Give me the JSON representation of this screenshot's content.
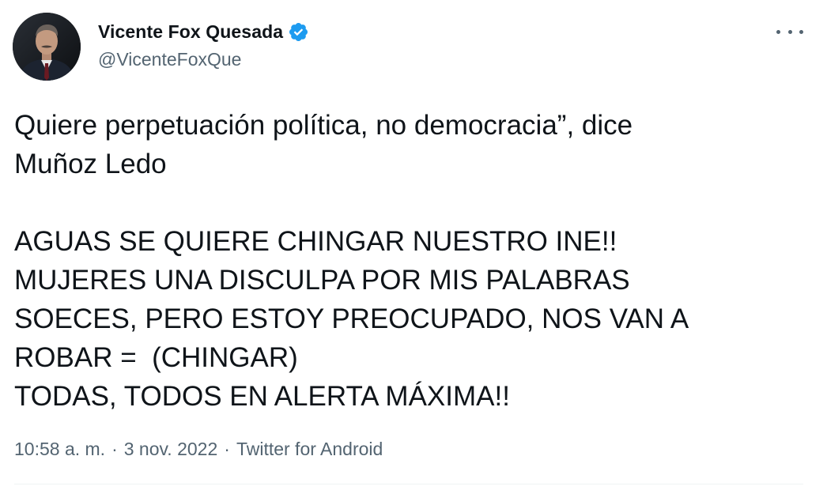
{
  "author": {
    "display_name": "Vicente Fox Quesada",
    "handle": "@VicenteFoxQue",
    "verified": true
  },
  "tweet": {
    "text": "Quiere perpetuación política, no democracia”, dice\nMuñoz Ledo\n\nAGUAS SE QUIERE CHINGAR NUESTRO INE!!\nMUJERES UNA DISCULPA POR MIS PALABRAS\nSOECES, PERO ESTOY PREOCUPADO, NOS VAN A\nROBAR =  (CHINGAR)\nTODAS, TODOS EN ALERTA MÁXIMA!!"
  },
  "meta": {
    "time": "10:58 a. m.",
    "separator": "·",
    "date": "3 nov. 2022",
    "source": "Twitter for Android"
  },
  "icons": {
    "verified": "verified-badge-icon",
    "more": "more-options-icon"
  },
  "colors": {
    "text": "#0f1419",
    "secondary": "#536471",
    "verified_blue": "#1d9bf0"
  }
}
